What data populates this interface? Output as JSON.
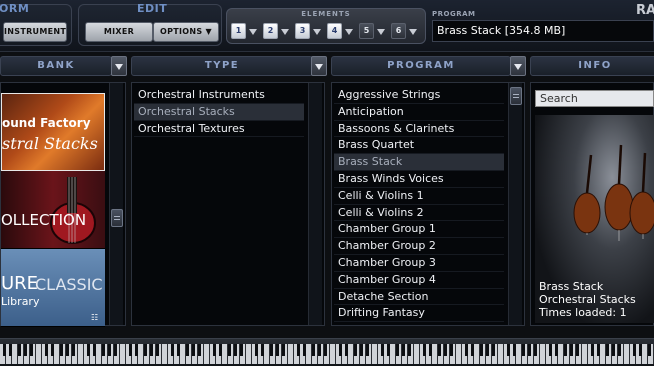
{
  "topbar": {
    "section_left_title": "ORM",
    "instrument_button": "INSTRUMENT",
    "edit_title": "EDIT",
    "mixer_button": "MIXER",
    "options_button": "OPTIONS ▼",
    "elements_title": "ELEMENTS",
    "elements": [
      "1",
      "2",
      "3",
      "4",
      "5",
      "6"
    ],
    "active_elements": [
      "1",
      "2",
      "3",
      "4"
    ],
    "program_label": "PROGRAM",
    "program_value": "Brass Stack [354.8 MB]",
    "brand_fragment": "RA"
  },
  "columns": {
    "bank": "BANK",
    "type": "TYPE",
    "program": "PROGRAM",
    "info": "INFO"
  },
  "bank_tiles": [
    {
      "line1": "ound Factory",
      "line2": "stral Stacks"
    },
    {
      "line1": "OLLECTION"
    },
    {
      "line1": "URE",
      "line1b": "CLASSIC",
      "line2": "Library"
    }
  ],
  "type_list": {
    "items": [
      "Orchestral Instruments",
      "Orchestral Stacks",
      "Orchestral Textures"
    ],
    "selected": "Orchestral Stacks"
  },
  "program_list": {
    "items": [
      "Aggressive Strings",
      "Anticipation",
      "Bassoons & Clarinets",
      "Brass Quartet",
      "Brass Stack",
      "Brass Winds Voices",
      "Celli & Violins 1",
      "Celli & Violins 2",
      "Chamber Group 1",
      "Chamber Group 2",
      "Chamber Group 3",
      "Chamber Group 4",
      "Detache Section",
      "Drifting Fantasy"
    ],
    "selected": "Brass Stack"
  },
  "info": {
    "search_placeholder": "Search",
    "program_name": "Brass Stack",
    "type_name": "Orchestral Stacks",
    "times_loaded": "Times loaded: 1"
  },
  "colors": {
    "accent": "#6f8fc4",
    "header_text": "#8fa3c9",
    "selected_row": "#2a2f38",
    "list_bg": "#05070a"
  }
}
